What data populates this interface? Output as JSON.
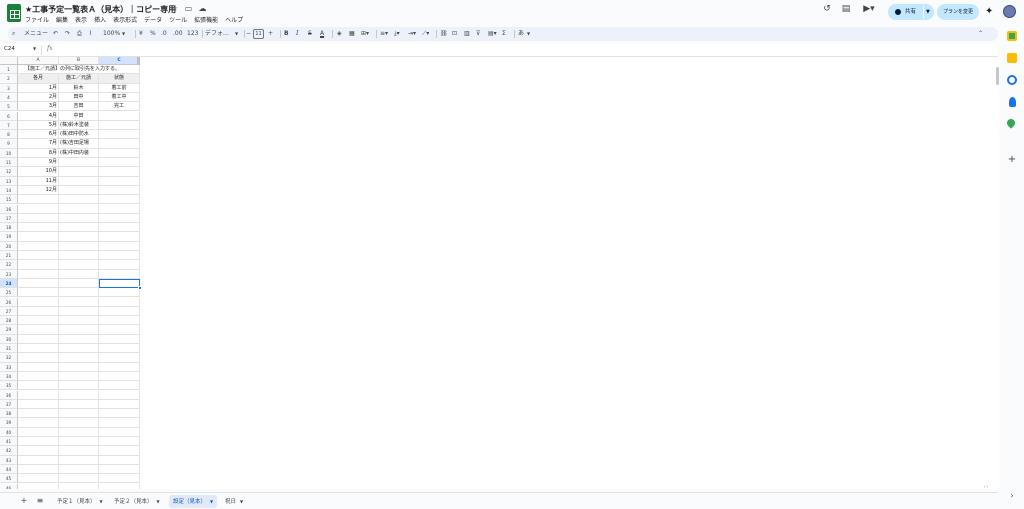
{
  "app": {
    "doc_title": "★工事予定一覧表Ａ（見本）｜コピー専用",
    "menu": [
      "ファイル",
      "編集",
      "表示",
      "挿入",
      "表示形式",
      "データ",
      "ツール",
      "拡張機能",
      "ヘルプ"
    ],
    "share_label": "共有",
    "plan_label": "プランを変更"
  },
  "toolbar": {
    "search_label": "メニュー",
    "zoom": "100%",
    "currency": "¥",
    "percent": "%",
    "dec_decrease": ".0",
    "dec_increase": ".00",
    "number_format": "123",
    "font_name": "デフォ...",
    "font_size": "11",
    "minus": "−",
    "plus": "+",
    "bold": "B",
    "italic": "I",
    "strike": "S",
    "text_color": "A",
    "sigma": "Σ",
    "input_tools": "あ"
  },
  "formula_bar": {
    "namebox": "C24",
    "fx": "fx"
  },
  "grid": {
    "columns": [
      "A",
      "B",
      "C"
    ],
    "selected_column": "C",
    "selected_row": 24,
    "row_count": 48,
    "note": "【施工／元請】の列に取引先を入力する。",
    "headers": [
      "各月",
      "施工／元請",
      "状態"
    ],
    "rows": [
      {
        "month": "1月",
        "contractor": "鈴木",
        "status": "着工前"
      },
      {
        "month": "2月",
        "contractor": "田中",
        "status": "着工中"
      },
      {
        "month": "3月",
        "contractor": "吉田",
        "status": "完工"
      },
      {
        "month": "4月",
        "contractor": "中田",
        "status": ""
      },
      {
        "month": "5月",
        "contractor": "(株)鈴木塗装",
        "status": ""
      },
      {
        "month": "6月",
        "contractor": "(株)田中防水",
        "status": ""
      },
      {
        "month": "7月",
        "contractor": "(株)吉田足場",
        "status": ""
      },
      {
        "month": "8月",
        "contractor": "(株)中田内装",
        "status": ""
      },
      {
        "month": "9月",
        "contractor": "",
        "status": ""
      },
      {
        "month": "10月",
        "contractor": "",
        "status": ""
      },
      {
        "month": "11月",
        "contractor": "",
        "status": ""
      },
      {
        "month": "12月",
        "contractor": "",
        "status": ""
      }
    ]
  },
  "sheets": {
    "tabs": [
      {
        "label": "予定１（見本）",
        "active": false
      },
      {
        "label": "予定２（見本）",
        "active": false
      },
      {
        "label": "設定（見本）",
        "active": true
      },
      {
        "label": "祝日",
        "active": false
      }
    ]
  },
  "colors": {
    "accent": "#1a73e8",
    "share_bg": "#c2e7ff",
    "sheets_green": "#188038",
    "selected_header": "#d3e3fd"
  }
}
